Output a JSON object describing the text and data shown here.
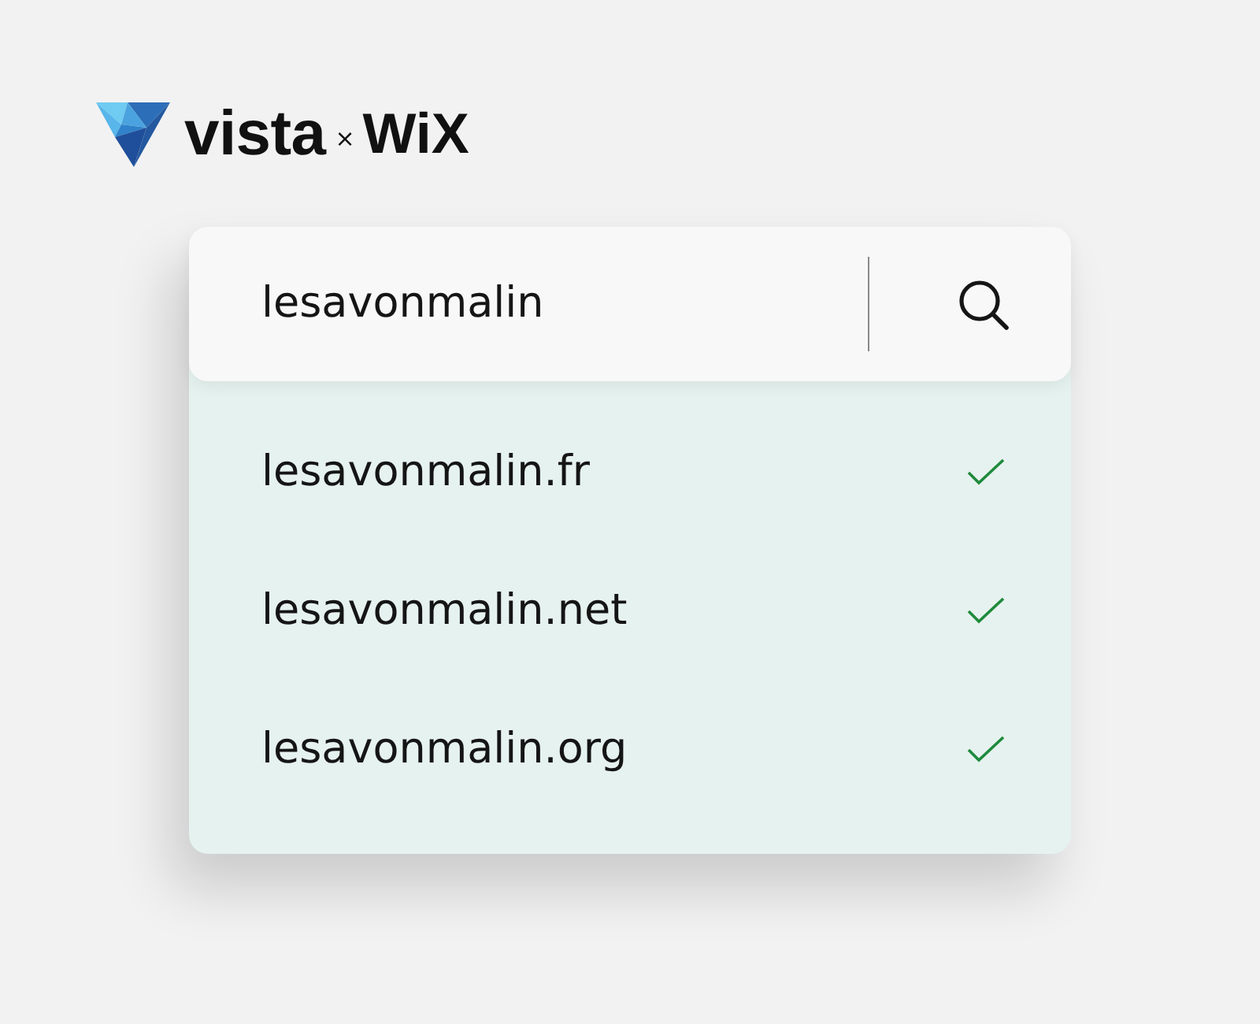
{
  "logo": {
    "brand": "vista",
    "separator": "×",
    "partner": "WiX"
  },
  "search": {
    "value": "lesavonmalin"
  },
  "results": [
    {
      "domain": "lesavonmalin.fr",
      "available": true
    },
    {
      "domain": "lesavonmalin.net",
      "available": true
    },
    {
      "domain": "lesavonmalin.org",
      "available": true
    }
  ]
}
